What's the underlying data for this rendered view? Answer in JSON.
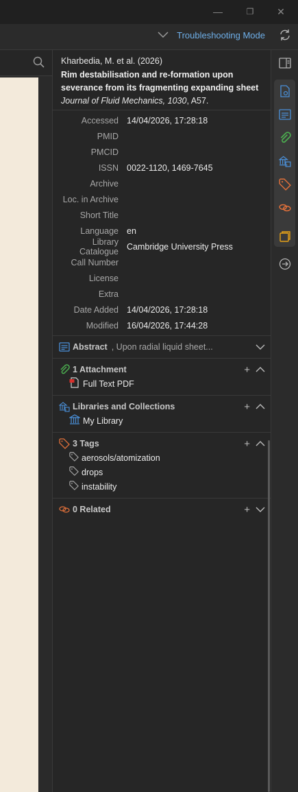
{
  "window": {
    "minimize": "—",
    "maximize": "❐",
    "close": "✕"
  },
  "toolbar": {
    "troubleshooting_label": "Troubleshooting Mode"
  },
  "item": {
    "citation": "Kharbedia, M. et al. (2026)",
    "title": "Rim destabilisation and re-formation upon severance from its fragmenting expanding sheet",
    "journal_name": "Journal of Fluid Mechanics, 1030",
    "journal_rest": ", A57."
  },
  "fields": [
    {
      "label": "Accessed",
      "value": "14/04/2026, 17:28:18"
    },
    {
      "label": "PMID",
      "value": ""
    },
    {
      "label": "PMCID",
      "value": ""
    },
    {
      "label": "ISSN",
      "value": "0022-1120, 1469-7645"
    },
    {
      "label": "Archive",
      "value": ""
    },
    {
      "label": "Loc. in Archive",
      "value": ""
    },
    {
      "label": "Short Title",
      "value": ""
    },
    {
      "label": "Language",
      "value": "en"
    },
    {
      "label": "Library Catalogue",
      "value": "Cambridge University Press"
    },
    {
      "label": "Call Number",
      "value": ""
    },
    {
      "label": "License",
      "value": ""
    },
    {
      "label": "Extra",
      "value": ""
    },
    {
      "label": "Date Added",
      "value": "14/04/2026, 17:28:18"
    },
    {
      "label": "Modified",
      "value": "16/04/2026, 17:44:28"
    }
  ],
  "abstract": {
    "title": "Abstract",
    "preview": ", Upon radial liquid sheet..."
  },
  "attachments": {
    "title": "1 Attachment",
    "items": [
      "Full Text PDF"
    ]
  },
  "libraries": {
    "title": "Libraries and Collections",
    "items": [
      "My Library"
    ]
  },
  "tags": {
    "title": "3 Tags",
    "items": [
      "aerosols/atomization",
      "drops",
      "instability"
    ]
  },
  "related": {
    "title": "0 Related"
  },
  "colors": {
    "accent": "#6fb0ea",
    "abstract_icon": "#4a90d9",
    "attachment_icon": "#4caf50",
    "library_icon": "#4a90d9",
    "tag_icon": "#e0703a",
    "related_icon": "#e0703a",
    "notes_icon": "#e8a317"
  }
}
